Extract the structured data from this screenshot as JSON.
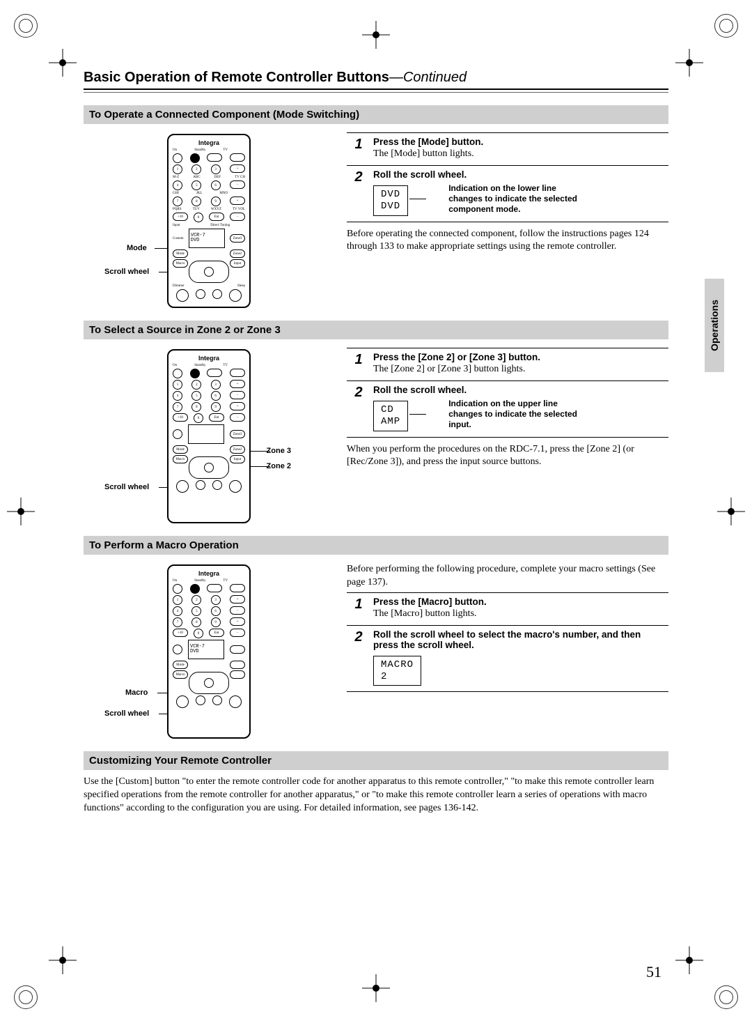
{
  "header": {
    "title_main": "Basic Operation of Remote Controller Buttons",
    "title_cont": "—Continued"
  },
  "side_tab": "Operations",
  "sections": {
    "s1": {
      "bar": "To Operate a Connected Component (Mode Switching)",
      "remote": {
        "brand": "Integra",
        "disp_l1": "VCR-7",
        "disp_l2": "DVD",
        "callouts": {
          "mode": "Mode",
          "scroll": "Scroll wheel"
        }
      },
      "steps": [
        {
          "num": "1",
          "head": "Press the [Mode] button.",
          "desc": "The [Mode] button lights."
        },
        {
          "num": "2",
          "head": "Roll the scroll wheel.",
          "lcd_l1": "DVD",
          "lcd_l2": "DVD",
          "note": "Indication on the lower line changes to indicate the selected component mode."
        }
      ],
      "para": "Before operating the connected component, follow the instructions pages 124 through 133 to make appropriate settings using the remote controller."
    },
    "s2": {
      "bar": "To Select a Source in Zone 2 or Zone 3",
      "remote": {
        "brand": "Integra",
        "disp_l1": "",
        "disp_l2": "",
        "callouts": {
          "zone3": "Zone 3",
          "zone2": "Zone 2",
          "scroll": "Scroll wheel"
        }
      },
      "steps": [
        {
          "num": "1",
          "head": "Press the [Zone 2] or [Zone 3] button.",
          "desc": "The [Zone 2] or [Zone 3] button lights."
        },
        {
          "num": "2",
          "head": "Roll the scroll wheel.",
          "lcd_l1": "CD",
          "lcd_l2": "AMP",
          "note": "Indication on the upper line changes to indicate the selected input."
        }
      ],
      "para": "When you perform the procedures on the RDC-7.1, press the [Zone 2] (or [Rec/Zone 3]), and press the input source buttons."
    },
    "s3": {
      "bar": "To Perform a Macro Operation",
      "remote": {
        "brand": "Integra",
        "disp_l1": "VCR-7",
        "disp_l2": "DVD",
        "callouts": {
          "macro": "Macro",
          "scroll": "Scroll wheel"
        }
      },
      "intro": "Before performing the following procedure, complete your macro settings (See page 137).",
      "steps": [
        {
          "num": "1",
          "head": "Press the [Macro] button.",
          "desc": "The [Macro] button lights."
        },
        {
          "num": "2",
          "head": "Roll the scroll wheel to select the macro's number, and then press the scroll wheel.",
          "lcd_l1": "MACRO",
          "lcd_l2": "2"
        }
      ]
    },
    "s4": {
      "bar": "Customizing Your Remote Controller",
      "para": "Use the [Custom] button \"to enter the remote controller code for another apparatus to this remote controller,\" \"to make this remote controller learn specified operations from the remote controller for another apparatus,\" or \"to make this remote controller learn a series of operations with macro functions\" according to the configuration you are using. For detailed information, see pages 136-142."
    }
  },
  "page_number": "51"
}
